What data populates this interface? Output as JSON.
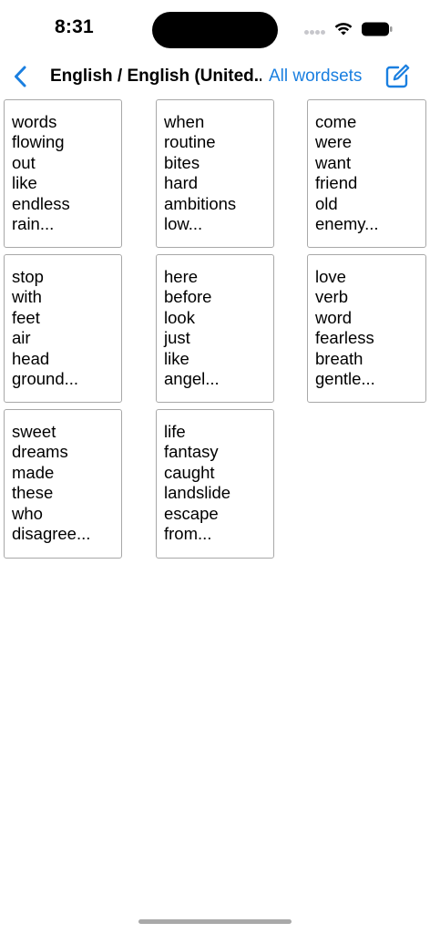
{
  "status_bar": {
    "time": "8:31"
  },
  "nav": {
    "back_icon": "chevron-left-icon",
    "title": "English / English (United...",
    "link_label": "All wordsets",
    "compose_icon": "square-and-pencil-icon",
    "accent_color": "#1a7fe0"
  },
  "cards": [
    {
      "words": [
        "words",
        "flowing",
        "out",
        "like",
        "endless",
        "rain..."
      ]
    },
    {
      "words": [
        "when",
        "routine",
        "bites",
        "hard",
        "ambitions",
        "low..."
      ]
    },
    {
      "words": [
        "come",
        "were",
        "want",
        "friend",
        "old",
        "enemy..."
      ]
    },
    {
      "words": [
        "stop",
        "with",
        "feet",
        "air",
        "head",
        "ground..."
      ]
    },
    {
      "words": [
        "here",
        "before",
        "look",
        "just",
        "like",
        "angel..."
      ]
    },
    {
      "words": [
        "love",
        "verb",
        "word",
        "fearless",
        "breath",
        "gentle..."
      ]
    },
    {
      "words": [
        "sweet",
        "dreams",
        "made",
        "these",
        "who",
        "disagree..."
      ]
    },
    {
      "words": [
        "life",
        "fantasy",
        "caught",
        "landslide",
        "escape",
        "from..."
      ]
    }
  ]
}
